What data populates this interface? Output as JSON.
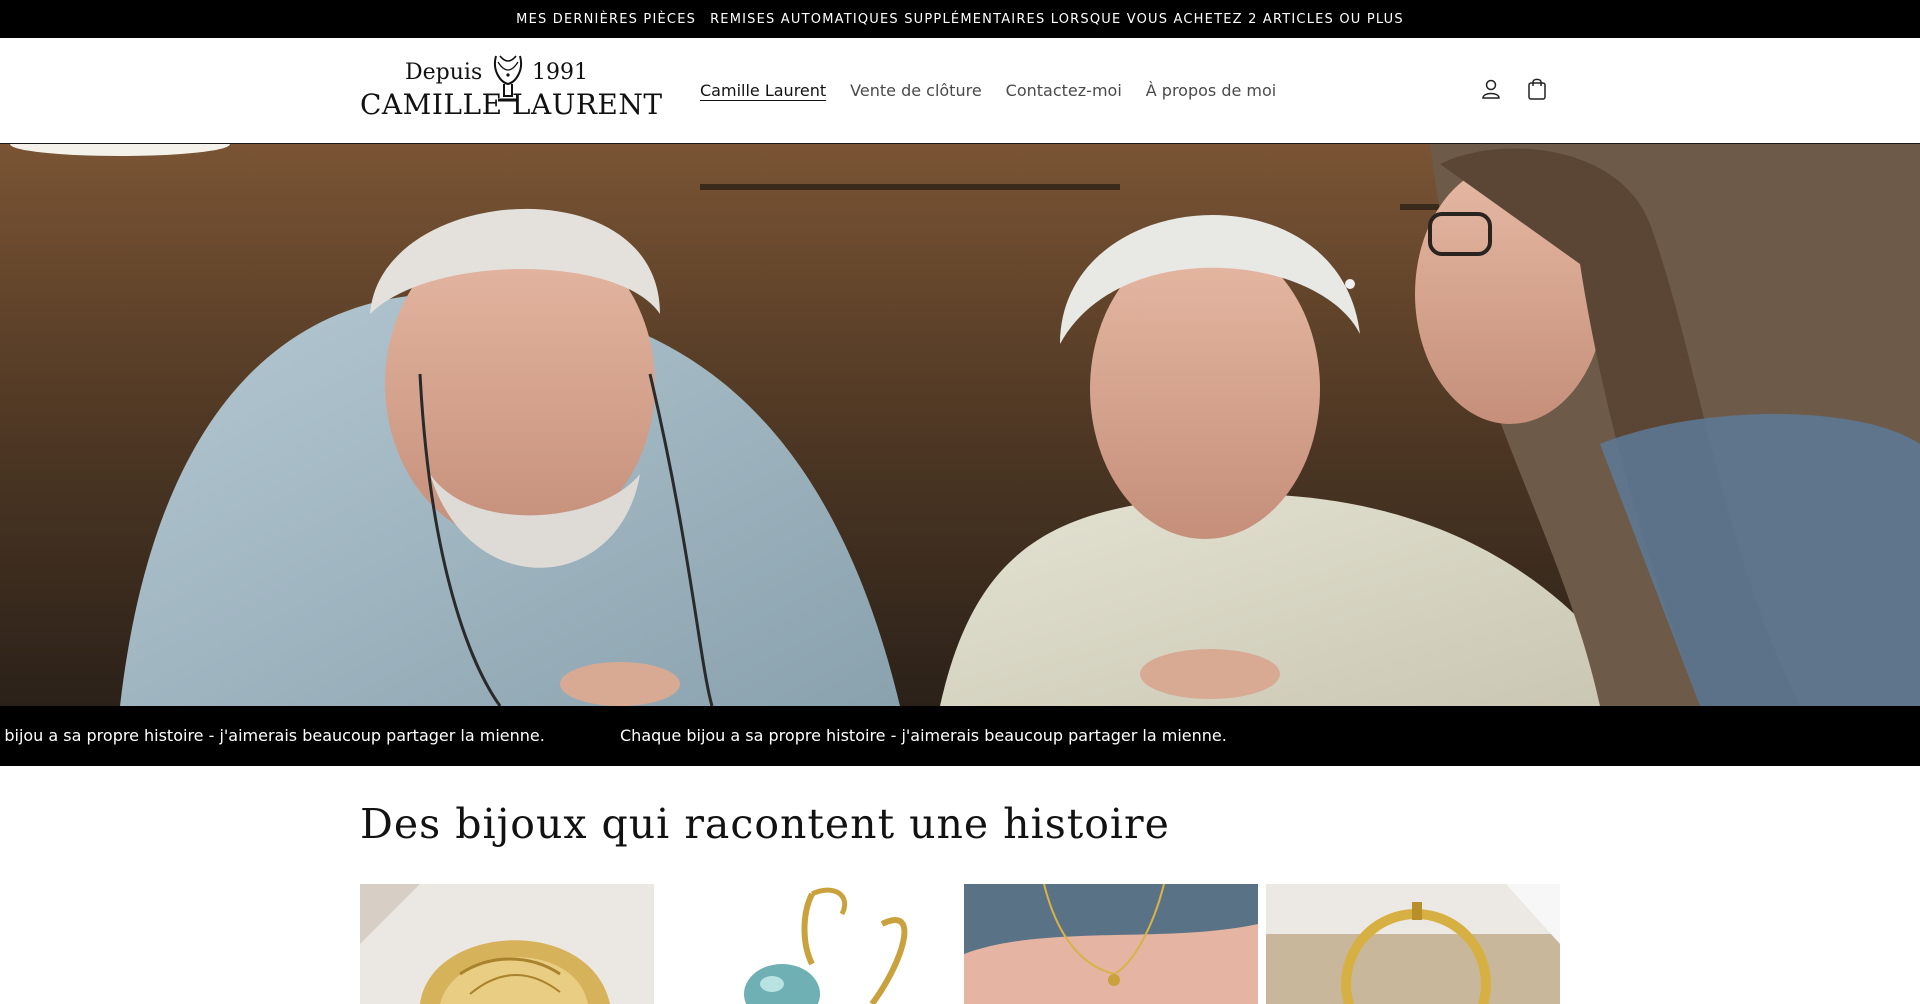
{
  "announcement": {
    "link_text": "MES DERNIÈRES PIÈCES",
    "message": "REMISES AUTOMATIQUES SUPPLÉMENTAIRES LORSQUE VOUS ACHETEZ 2 ARTICLES OU PLUS"
  },
  "logo": {
    "depuis": "Depuis",
    "year": "1991",
    "name": "CAMILLE LAURENT"
  },
  "nav": {
    "items": [
      {
        "label": "Camille Laurent",
        "active": true
      },
      {
        "label": "Vente de clôture",
        "active": false
      },
      {
        "label": "Contactez-moi",
        "active": false
      },
      {
        "label": "À propos de moi",
        "active": false
      }
    ]
  },
  "header_icons": [
    "account-icon",
    "cart-icon"
  ],
  "hero": {
    "image": "photo-three-people-working-on-jewelry-in-workshop"
  },
  "marquee": {
    "text_1": "Chaque bijou a sa propre histoire - j'aimerais beaucoup partager la mienne.",
    "text_2": "Chaque bijou a sa propre histoire - j'aimerais beaucoup partager la mienne."
  },
  "collection": {
    "title": "Des bijoux qui racontent une histoire",
    "products": [
      {
        "image": "gold-engraved-ring"
      },
      {
        "image": "gold-earring-with-blue-stone"
      },
      {
        "image": "gold-chain-necklace-on-finger"
      },
      {
        "image": "gold-hoop-earring"
      }
    ]
  },
  "colors": {
    "bar_background": "#000000",
    "page_background": "#ffffff",
    "text": "#121212",
    "gold": "#c9a23e"
  }
}
